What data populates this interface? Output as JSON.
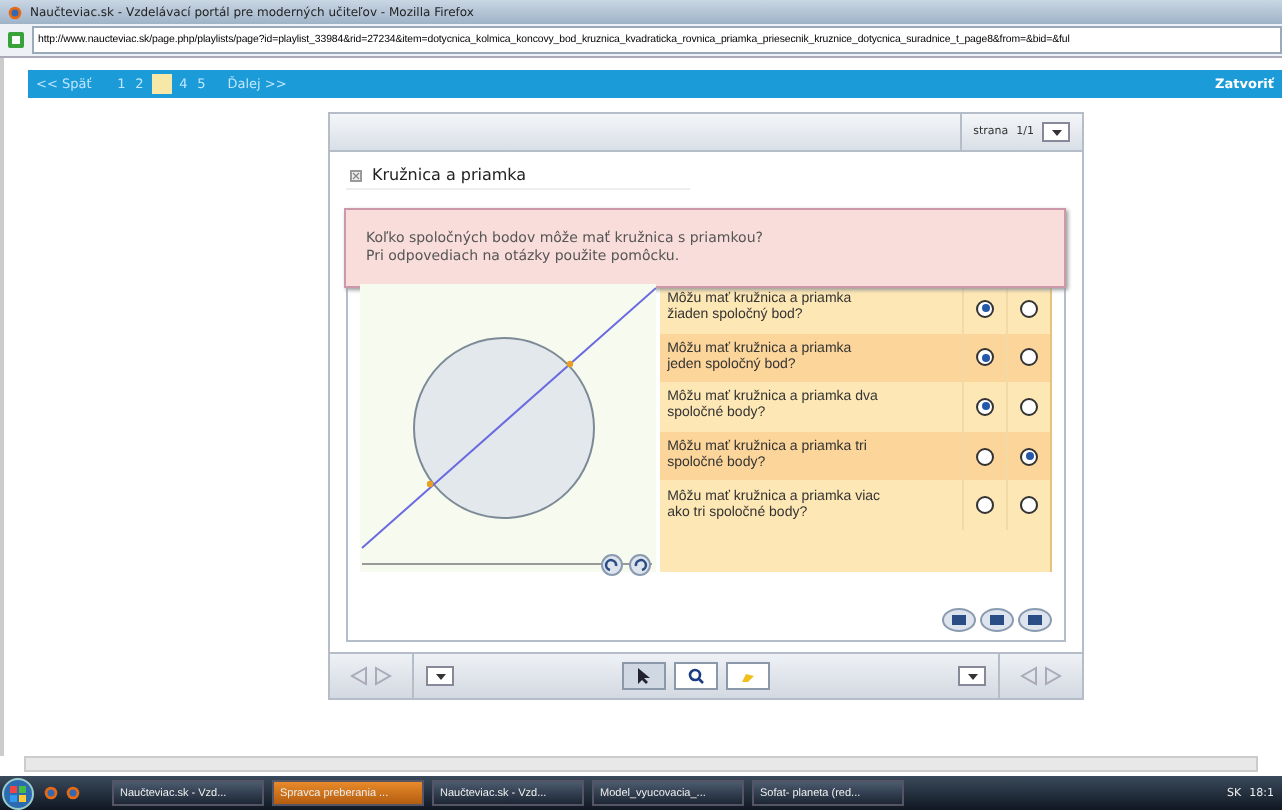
{
  "window": {
    "title": "Naučteviac.sk - Vzdelávací portál pre moderných učiteľov - Mozilla Firefox"
  },
  "address_bar": {
    "url": "http://www.naucteviac.sk/page.php/playlists/page?id=playlist_33984&rid=27234&item=dotycnica_kolmica_koncovy_bod_kruznica_kvadraticka_rovnica_priamka_priesecnik_kruznice_dotycnica_suradnice_t_page8&from=&bid=&ful"
  },
  "nav": {
    "back": "<< Späť",
    "pages": [
      {
        "label": "1",
        "selected": false
      },
      {
        "label": "2",
        "selected": false
      },
      {
        "selected": true
      },
      {
        "label": "4",
        "selected": false
      },
      {
        "label": "5",
        "selected": false
      }
    ],
    "next": "Ďalej >>",
    "close": "Zatvoriť"
  },
  "panel": {
    "page_label": "strana",
    "page_value": "1/1",
    "heading": "Kružnica a priamka",
    "prompt": [
      "Koľko spoločných bodov môže mať kružnica s priamkou?",
      "Pri odpovediach na otázky použite pomôcku."
    ],
    "questions": [
      {
        "text": "Môžu mať kružnica a priamka žiaden spoločný bod?",
        "answers": [
          {
            "selected": true
          },
          {
            "selected": false
          }
        ]
      },
      {
        "text": "Môžu mať kružnica a priamka jeden spoločný bod?",
        "answers": [
          {
            "selected": true
          },
          {
            "selected": false
          }
        ]
      },
      {
        "text": "Môžu mať kružnica a priamka dva spoločné body?",
        "answers": [
          {
            "selected": true
          },
          {
            "selected": false
          }
        ]
      },
      {
        "text": "Môžu mať kružnica a priamka tri spoločné body?",
        "answers": [
          {
            "selected": false
          },
          {
            "selected": true
          }
        ]
      },
      {
        "text": "Môžu mať kružnica a priamka viac ako tri spoločné body?",
        "answers": [
          {
            "selected": false
          },
          {
            "selected": false
          }
        ]
      }
    ]
  },
  "taskbar": {
    "items": [
      {
        "label": "Naučteviac.sk - Vzd...",
        "selected": false
      },
      {
        "label": "Spravca preberania ...",
        "selected": true
      },
      {
        "label": "Naučteviac.sk - Vzd...",
        "selected": false
      },
      {
        "label": "Model_vyucovacia_...",
        "selected": false
      },
      {
        "label": "Sofat- planeta (red...",
        "selected": false
      }
    ],
    "language": "SK",
    "clock": "18:1"
  }
}
